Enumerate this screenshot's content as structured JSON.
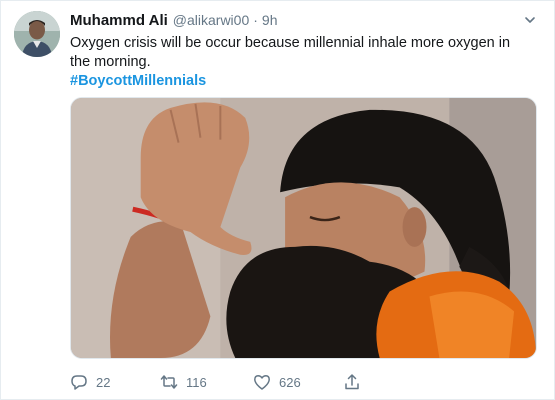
{
  "tweet": {
    "author_name": "Muhammd Ali",
    "handle": "@alikarwi00",
    "separator": "·",
    "time": "9h",
    "text": "Oxygen crisis will be occur because millennial inhale more oxygen in the morning.",
    "hashtag": "#BoycottMillennials"
  },
  "actions": {
    "replies": "22",
    "retweets": "116",
    "likes": "626"
  },
  "icons": {
    "reply": "reply-icon",
    "retweet": "retweet-icon",
    "like": "heart-icon",
    "share": "share-icon",
    "menu": "chevron-down-icon"
  },
  "colors": {
    "hashtag": "#1b95e0",
    "muted": "#657786",
    "text": "#14171a"
  }
}
